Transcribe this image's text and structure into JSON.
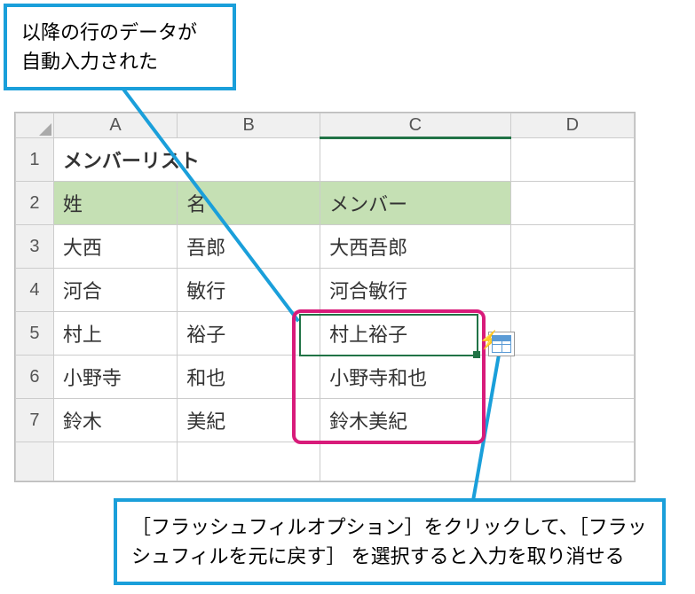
{
  "callouts": {
    "top": "以降の行のデータが\n自動入力された",
    "bottom": "［フラッシュフィルオプション］をクリックして、［フラッシュフィルを元に戻す］ を選択すると入力を取り消せる"
  },
  "columns": [
    "A",
    "B",
    "C",
    "D"
  ],
  "row_numbers": [
    "1",
    "2",
    "3",
    "4",
    "5",
    "6",
    "7"
  ],
  "title": "メンバーリスト",
  "headers": {
    "a": "姓",
    "b": "名",
    "c": "メンバー"
  },
  "rows": [
    {
      "a": "大西",
      "b": "吾郎",
      "c": "大西吾郎"
    },
    {
      "a": "河合",
      "b": "敏行",
      "c": "河合敏行"
    },
    {
      "a": "村上",
      "b": "裕子",
      "c": "村上裕子"
    },
    {
      "a": "小野寺",
      "b": "和也",
      "c": "小野寺和也"
    },
    {
      "a": "鈴木",
      "b": "美紀",
      "c": "鈴木美紀"
    }
  ],
  "chart_data": {
    "type": "table",
    "title": "メンバーリスト",
    "columns": [
      "姓",
      "名",
      "メンバー"
    ],
    "rows": [
      [
        "大西",
        "吾郎",
        "大西吾郎"
      ],
      [
        "河合",
        "敏行",
        "河合敏行"
      ],
      [
        "村上",
        "裕子",
        "村上裕子"
      ],
      [
        "小野寺",
        "和也",
        "小野寺和也"
      ],
      [
        "鈴木",
        "美紀",
        "鈴木美紀"
      ]
    ]
  }
}
